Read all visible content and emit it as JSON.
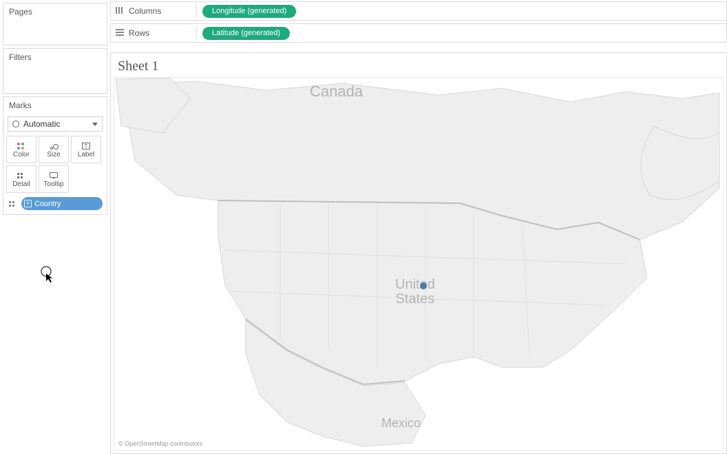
{
  "left": {
    "pages_title": "Pages",
    "filters_title": "Filters",
    "marks_title": "Marks",
    "mark_type": "Automatic",
    "mark_buttons": {
      "color": "Color",
      "size": "Size",
      "label": "Label",
      "detail": "Detail",
      "tooltip": "Tooltip"
    },
    "detail_pill": "Country"
  },
  "shelves": {
    "columns_label": "Columns",
    "columns_pill": "Longitude (generated)",
    "rows_label": "Rows",
    "rows_pill": "Latitude (generated)"
  },
  "sheet": {
    "title": "Sheet 1",
    "labels": {
      "canada": "Canada",
      "us_line1": "United",
      "us_line2": "States",
      "mexico": "Mexico"
    },
    "attribution": "© OpenStreetMap contributors"
  },
  "colors": {
    "measure_pill": "#1faa7d",
    "dimension_pill": "#5b9bd5",
    "data_point": "#4e79a7"
  }
}
